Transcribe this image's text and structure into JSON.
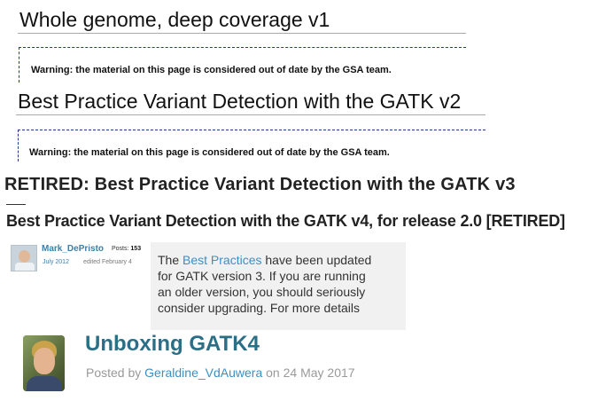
{
  "sections": [
    {
      "title": "Whole genome, deep coverage v1",
      "warning": "Warning: the material on this page is considered out of date by the GSA team."
    },
    {
      "title": "Best Practice Variant Detection with the GATK v2",
      "warning": "Warning: the material on this page is considered out of date by the GSA team."
    },
    {
      "title": "RETIRED: Best Practice Variant Detection with the GATK v3"
    },
    {
      "title": "Best Practice Variant Detection with the GATK v4, for release 2.0 [RETIRED]",
      "post": {
        "author": "Mark_DePristo",
        "posts_label": "Posts:",
        "posts_count": "153",
        "date": "July 2012",
        "edited": "edited February 4",
        "note": {
          "line1_pre": "The ",
          "line1_link": "Best Practices",
          "line1_post": " have been updated",
          "line2": "for GATK version 3. If you are running",
          "line3": "an older version, you should seriously",
          "line4": "consider upgrading. For more details"
        }
      }
    },
    {
      "title": "Unboxing GATK4",
      "byline_prefix": "Posted by ",
      "byline_author": "Geraldine_VdAuwera",
      "byline_suffix": " on 24 May 2017"
    }
  ],
  "colors": {
    "link": "#3c8fc4",
    "author_small": "#3c7fa8",
    "title_teal": "#2a6f86",
    "dashed_border": "#223a8a",
    "note_bg": "#f1f1f1"
  }
}
